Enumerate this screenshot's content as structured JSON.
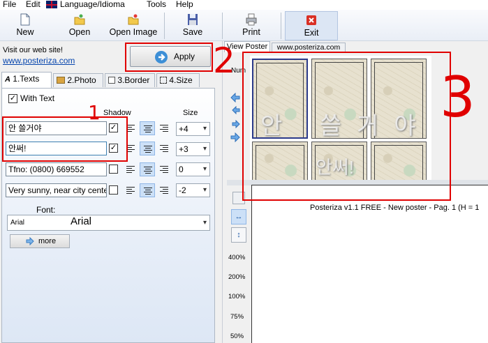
{
  "menu": {
    "items": [
      "File",
      "Edit",
      "Language/Idioma",
      "Tools",
      "Help"
    ]
  },
  "toolbar": {
    "new": "New",
    "open": "Open",
    "open_image": "Open Image",
    "save": "Save",
    "print": "Print",
    "exit": "Exit"
  },
  "left": {
    "visit": "Visit our web site!",
    "website": "www.posteriza.com",
    "apply": "Apply",
    "tabs": [
      "1.Texts",
      "2.Photo",
      "3.Border",
      "4.Size"
    ],
    "with_text": "With Text",
    "shadow_header": "Shadow",
    "size_header": "Size",
    "rows": [
      {
        "text": "안 쓸거야",
        "shadow": true,
        "size": "+4"
      },
      {
        "text": "안써!",
        "shadow": true,
        "size": "+3"
      },
      {
        "text": "Tfno: (0800) 669552",
        "shadow": false,
        "size": "0"
      },
      {
        "text": "Very sunny, near city center",
        "shadow": false,
        "size": "-2"
      }
    ],
    "font_label": "Font:",
    "font_name": "Arial",
    "font_preview": "Arial",
    "more": "more"
  },
  "right": {
    "tab_view": "View Poster",
    "tab_web": "www.posteriza.com",
    "num_label": "Num",
    "status": "Posteriza v1.1 FREE - New poster - Pag. 1 (H = 1",
    "zoom_levels": [
      "400%",
      "200%",
      "100%",
      "75%",
      "50%"
    ],
    "poster_line1": "안 쓸거야",
    "poster_line2": "안써!"
  },
  "annotations": {
    "n1": "1",
    "n2": "2",
    "n3": "3"
  },
  "colors": {
    "annotation": "#e00000",
    "link": "#0645ad",
    "selected": "#cce0f7"
  }
}
